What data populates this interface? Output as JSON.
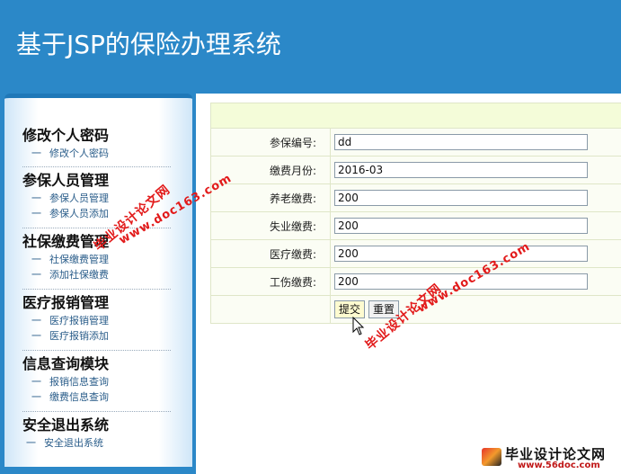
{
  "header": {
    "title": "基于JSP的保险办理系统"
  },
  "sidebar": {
    "sections": [
      {
        "title": "修改个人密码",
        "links": [
          "修改个人密码"
        ]
      },
      {
        "title": "参保人员管理",
        "links": [
          "参保人员管理",
          "参保人员添加"
        ]
      },
      {
        "title": "社保缴费管理",
        "links": [
          "社保缴费管理",
          "添加社保缴费"
        ]
      },
      {
        "title": "医疗报销管理",
        "links": [
          "医疗报销管理",
          "医疗报销添加"
        ]
      },
      {
        "title": "信息查询模块",
        "links": [
          "报销信息查询",
          "缴费信息查询"
        ]
      },
      {
        "title": "安全退出系统",
        "links": [
          "安全退出系统"
        ]
      }
    ],
    "dash": "一"
  },
  "form": {
    "fields": [
      {
        "label": "参保编号:",
        "value": "dd"
      },
      {
        "label": "缴费月份:",
        "value": "2016-03"
      },
      {
        "label": "养老缴费:",
        "value": "200"
      },
      {
        "label": "失业缴费:",
        "value": "200"
      },
      {
        "label": "医疗缴费:",
        "value": "200"
      },
      {
        "label": "工伤缴费:",
        "value": "200"
      }
    ],
    "submit_label": "提交",
    "reset_label": "重置"
  },
  "watermarks": {
    "site_text": "毕业设计论文网",
    "url_text": "www.doc163.com",
    "logo_text": "毕业设计论文网",
    "logo_url": "www.56doc.com"
  }
}
